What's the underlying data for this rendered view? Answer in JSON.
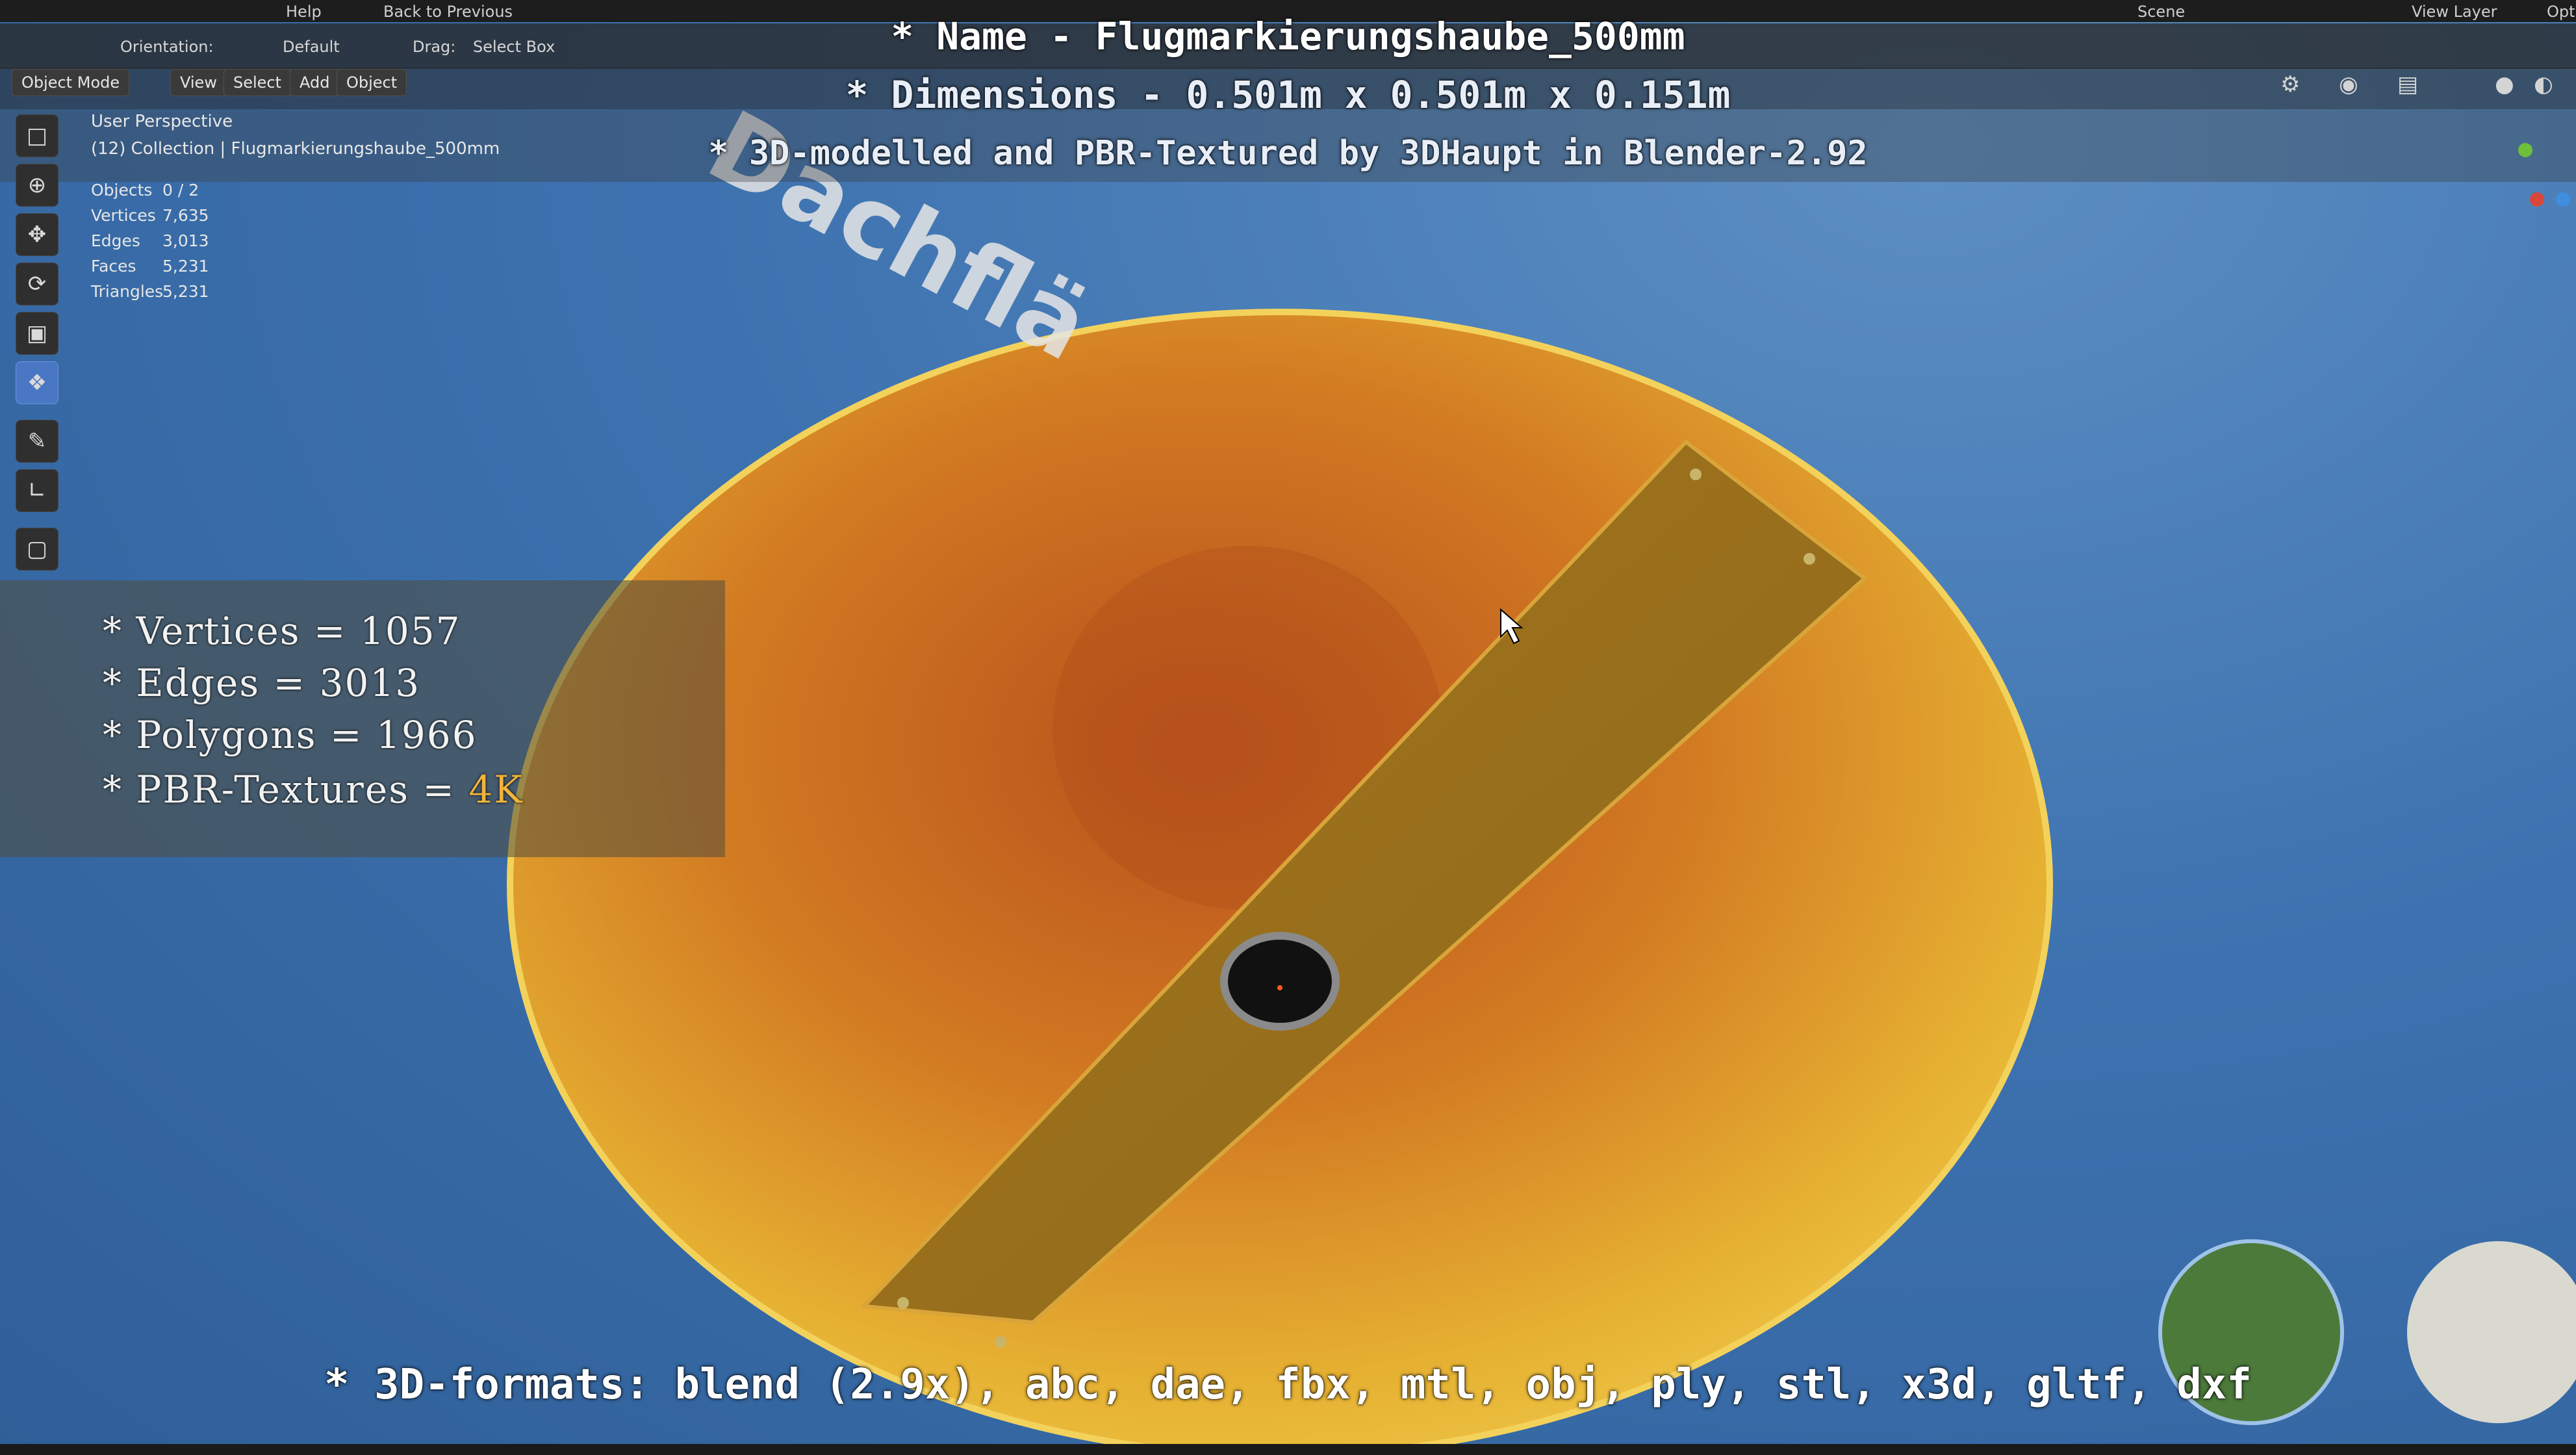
{
  "menu": {
    "help": "Help",
    "back": "Back to Previous",
    "scene": "Scene",
    "view_layer": "View Layer",
    "options": "Options"
  },
  "header": {
    "mode": "Object Mode",
    "view": "View",
    "select": "Select",
    "add": "Add",
    "object": "Object",
    "orientation": "Orientation:",
    "default": "Default",
    "drag": "Drag:",
    "select_box": "Select Box"
  },
  "viewport": {
    "perspective": "User Perspective",
    "collection": "(12) Collection | Flugmarkierungshaube_500mm",
    "stats": [
      {
        "label": "Objects",
        "value": "0 / 2"
      },
      {
        "label": "Vertices",
        "value": "7,635"
      },
      {
        "label": "Edges",
        "value": "3,013"
      },
      {
        "label": "Faces",
        "value": "5,231"
      },
      {
        "label": "Triangles",
        "value": "5,231"
      }
    ]
  },
  "overlay": {
    "name_line": "* Name - Flugmarkierungshaube_500mm",
    "dimensions_line": "* Dimensions -  0.501m x 0.501m x 0.151m",
    "author_line": "* 3D-modelled and PBR-Textured by 3DHaupt in Blender-2.92",
    "specs": {
      "vertices": "* Vertices = 1057",
      "edges": "* Edges = 3013",
      "polygons": "* Polygons = 1966",
      "pbr_prefix": "* PBR-Textures = ",
      "pbr_value": "4K"
    },
    "formats_line": "* 3D-formats: blend (2.9x), abc, dae, fbx, mtl, obj, ply, stl, x3d, gltf, dxf",
    "sign_text": "Dachflä"
  },
  "colors": {
    "accent": "#f1b33a",
    "hood_yellow": "#e5b531",
    "hood_orange": "#c9641f",
    "sky": "#3d72b0"
  },
  "icons": [
    "select-box-icon",
    "cursor-icon",
    "move-icon",
    "rotate-icon",
    "scale-icon",
    "transform-icon",
    "annotate-icon",
    "measure-icon",
    "add-cube-icon"
  ]
}
